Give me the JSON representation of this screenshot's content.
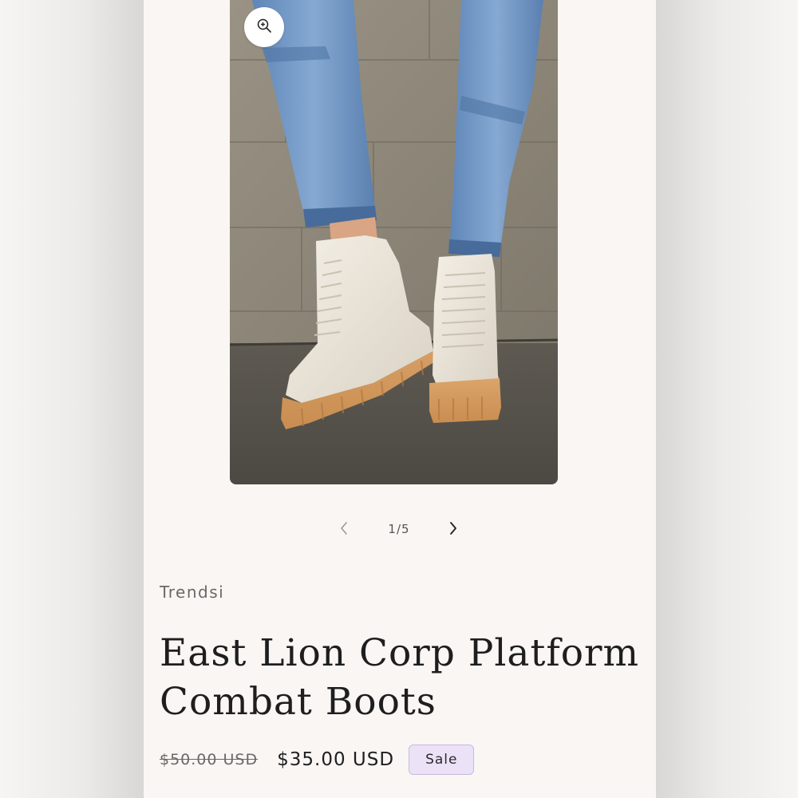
{
  "gallery": {
    "image_subject": "boots-photo",
    "counter": "1/5",
    "zoom_icon": "zoom-in-icon",
    "prev_icon": "chevron-left-icon",
    "next_icon": "chevron-right-icon"
  },
  "product": {
    "vendor": "Trendsi",
    "title": "East Lion Corp Platform Combat Boots",
    "price_regular": "$50.00 USD",
    "price_sale": "$35.00 USD",
    "badge": "Sale"
  },
  "colors": {
    "badge_bg": "#ece2f7",
    "badge_border": "#c9b8df",
    "page_bg": "#f9f6f4"
  }
}
